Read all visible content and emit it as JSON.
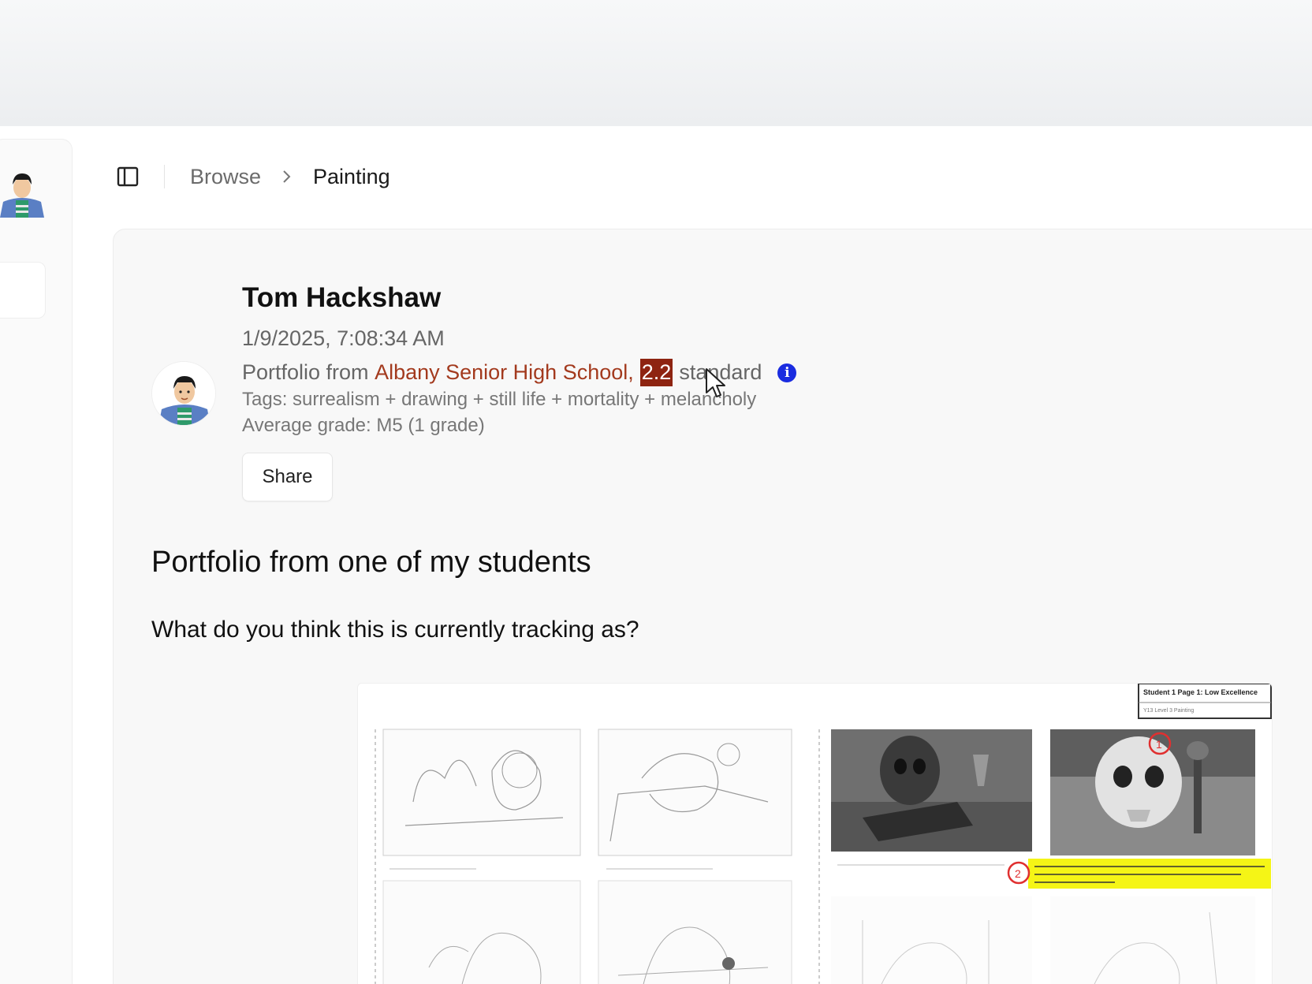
{
  "breadcrumb": {
    "items": [
      "Browse",
      "Painting"
    ]
  },
  "post": {
    "author": "Tom Hackshaw",
    "timestamp": "1/9/2025, 7:08:34 AM",
    "portfolio_prefix": "Portfolio from ",
    "school": "Albany Senior High School,",
    "standard_value": "2.2",
    "standard_label": "standard",
    "tags": "Tags: surrealism + drawing + still life + mortality + melancholy",
    "average_grade": "Average grade: M5 (1 grade)",
    "share_label": "Share",
    "title": "Portfolio from one of my students",
    "body": "What do you think this is currently tracking as?"
  },
  "portfolio_sheet": {
    "header_line1": "Student 1 Page 1: Low Excellence",
    "header_line2": "Y13 Level 3 Painting"
  },
  "icons": {
    "sidebar_toggle": "sidebar-toggle-icon",
    "breadcrumb_separator": "chevron-right-icon",
    "info": "info-icon",
    "cursor": "mouse-pointer-icon"
  },
  "colors": {
    "school_link": "#a33a1e",
    "standard_highlight": "#8e2411",
    "info_blue": "#1a2ce0",
    "annotation_yellow": "#f5f516",
    "annotation_red": "#e03030"
  }
}
